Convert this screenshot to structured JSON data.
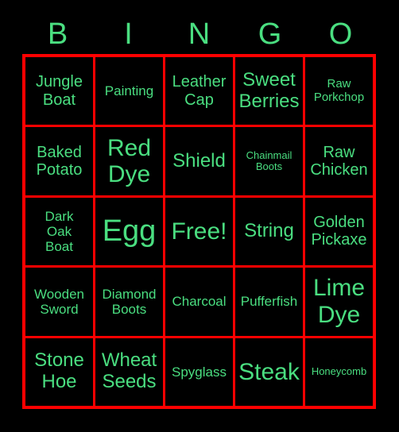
{
  "card": {
    "background_color": "#000000",
    "border_color": "#ff0000",
    "text_color": "#4ade80"
  },
  "header": {
    "letters": [
      {
        "label": "B"
      },
      {
        "label": "I"
      },
      {
        "label": "N"
      },
      {
        "label": "G"
      },
      {
        "label": "O"
      }
    ]
  },
  "grid": {
    "rows": 5,
    "columns": 5,
    "free_space": "Free!",
    "cells": [
      [
        {
          "label": "Jungle\nBoat",
          "size": "lg"
        },
        {
          "label": "Painting",
          "size": "md"
        },
        {
          "label": "Leather\nCap",
          "size": "lg"
        },
        {
          "label": "Sweet\nBerries",
          "size": "xl"
        },
        {
          "label": "Raw\nPorkchop",
          "size": "sm"
        }
      ],
      [
        {
          "label": "Baked\nPotato",
          "size": "lg"
        },
        {
          "label": "Red\nDye",
          "size": "xxl"
        },
        {
          "label": "Shield",
          "size": "xl"
        },
        {
          "label": "Chainmail\nBoots",
          "size": "xs"
        },
        {
          "label": "Raw\nChicken",
          "size": "lg"
        }
      ],
      [
        {
          "label": "Dark\nOak\nBoat",
          "size": "md"
        },
        {
          "label": "Egg",
          "size": "huge"
        },
        {
          "label": "Free!",
          "size": "xxl"
        },
        {
          "label": "String",
          "size": "xl"
        },
        {
          "label": "Golden\nPickaxe",
          "size": "lg"
        }
      ],
      [
        {
          "label": "Wooden\nSword",
          "size": "md"
        },
        {
          "label": "Diamond\nBoots",
          "size": "md"
        },
        {
          "label": "Charcoal",
          "size": "md"
        },
        {
          "label": "Pufferfish",
          "size": "md"
        },
        {
          "label": "Lime\nDye",
          "size": "xxl"
        }
      ],
      [
        {
          "label": "Stone\nHoe",
          "size": "xl"
        },
        {
          "label": "Wheat\nSeeds",
          "size": "xl"
        },
        {
          "label": "Spyglass",
          "size": "md"
        },
        {
          "label": "Steak",
          "size": "xxl"
        },
        {
          "label": "Honeycomb",
          "size": "xs"
        }
      ]
    ]
  }
}
